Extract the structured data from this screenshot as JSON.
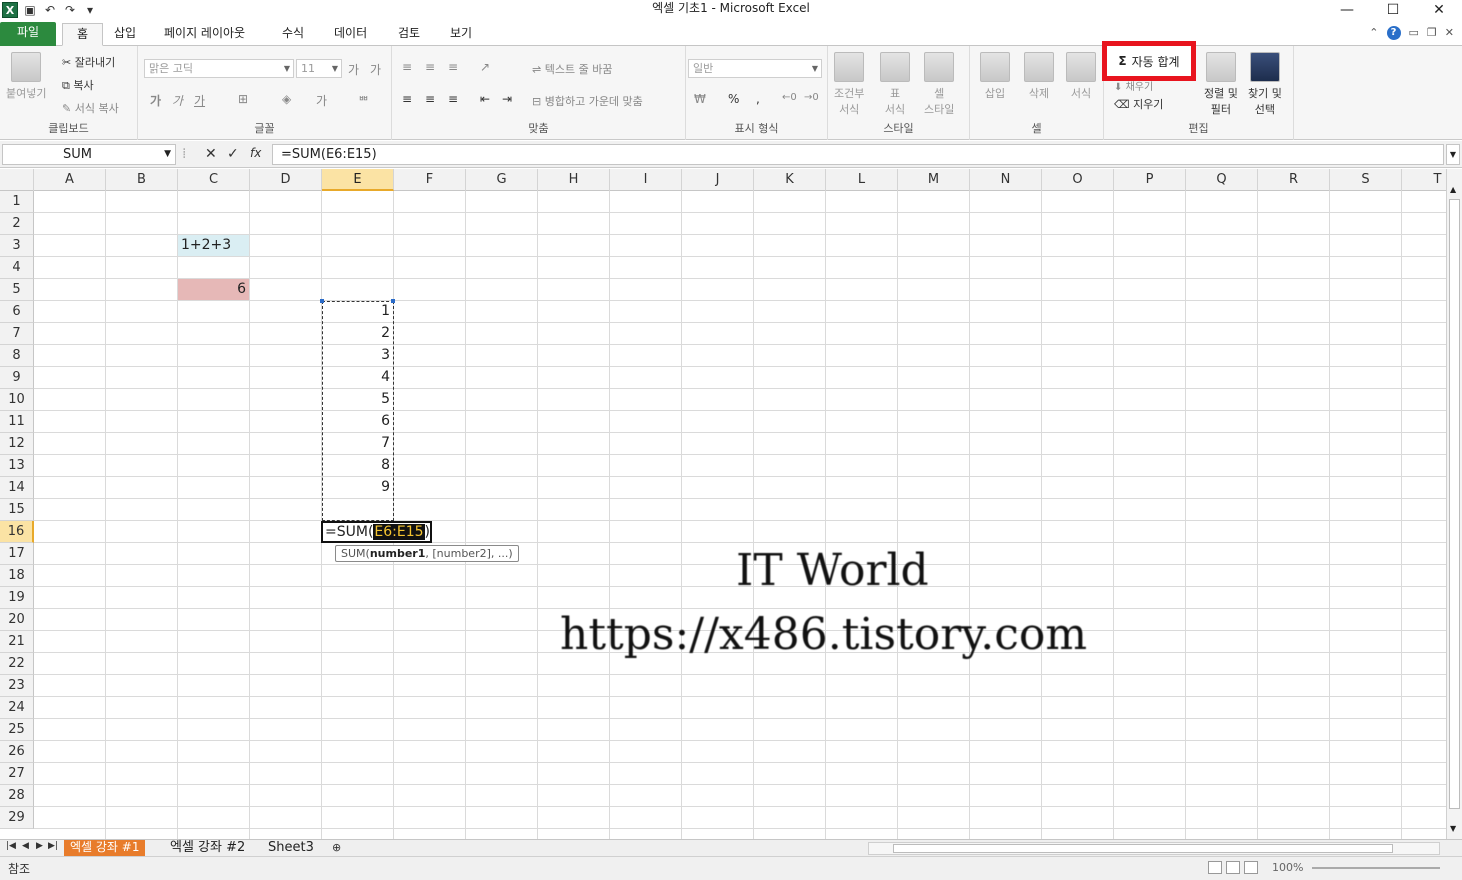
{
  "window": {
    "title": "엑셀 기초1  -  Microsoft Excel",
    "qat": [
      "save-icon",
      "undo-icon",
      "redo-icon",
      "customize-icon"
    ],
    "controls": [
      "—",
      "☐",
      "✕"
    ]
  },
  "tabs": [
    {
      "label": "파일"
    },
    {
      "label": "홈"
    },
    {
      "label": "삽입"
    },
    {
      "label": "페이지 레이아웃"
    },
    {
      "label": "수식"
    },
    {
      "label": "데이터"
    },
    {
      "label": "검토"
    },
    {
      "label": "보기"
    }
  ],
  "ribbon": {
    "clipboard": {
      "label": "클립보드",
      "paste": "붙여넣기",
      "cut": "잘라내기",
      "copy": "복사",
      "format_painter": "서식 복사"
    },
    "font": {
      "label": "글꼴",
      "font_name": "맑은 고딕",
      "font_size": "11",
      "bold": "가",
      "italic": "가",
      "underline": "가"
    },
    "alignment": {
      "label": "맞춤",
      "wrap_text": "텍스트 줄 바꿈",
      "merge_center": "병합하고 가운데 맞춤"
    },
    "number": {
      "label": "표시 형식",
      "format": "일반",
      "percent": "%",
      "comma": ","
    },
    "styles": {
      "label": "스타일",
      "conditional": "조건부\n서식",
      "table": "표\n서식",
      "cell_style": "셀\n스타일"
    },
    "cells": {
      "label": "셀",
      "insert": "삽입",
      "delete": "삭제",
      "format": "서식"
    },
    "editing": {
      "label": "편집",
      "autosum": "자동 합계",
      "fill": "채우기",
      "clear": "지우기",
      "sort_filter": "정렬 및\n필터",
      "find_select": "찾기 및\n선택"
    }
  },
  "formula_bar": {
    "name_box": "SUM",
    "cancel": "✕",
    "enter": "✓",
    "fx": "fx",
    "formula": "=SUM(E6:E15)"
  },
  "grid": {
    "columns": [
      "A",
      "B",
      "C",
      "D",
      "E",
      "F",
      "G",
      "H",
      "I",
      "J",
      "K",
      "L",
      "M",
      "N",
      "O",
      "P",
      "Q",
      "R",
      "S",
      "T"
    ],
    "rows": [
      "1",
      "2",
      "3",
      "4",
      "5",
      "6",
      "7",
      "8",
      "9",
      "10",
      "11",
      "12",
      "13",
      "14",
      "15",
      "16",
      "17",
      "18",
      "19",
      "20",
      "21",
      "22",
      "23",
      "24",
      "25",
      "26",
      "27",
      "28",
      "29"
    ],
    "selected_column": "E",
    "selected_row": "16",
    "c3": "1+2+3",
    "c5": "6",
    "e_values": [
      "1",
      "2",
      "3",
      "4",
      "5",
      "6",
      "7",
      "8",
      "9"
    ],
    "edit_prefix": "=SUM(",
    "edit_ref": "E6:E15",
    "edit_suffix": ")",
    "tooltip_fn": "SUM(",
    "tooltip_arg1": "number1",
    "tooltip_rest": ", [number2], ...)",
    "colors": {
      "c3_fill": "#daeef3",
      "c5_fill": "#e6b8b7",
      "selection": "#fbe3a4",
      "autosum_highlight": "#e8141e"
    }
  },
  "watermark": {
    "line1": "IT World",
    "line2": "https://x486.tistory.com"
  },
  "sheets": [
    {
      "label": "엑셀 강좌 #1"
    },
    {
      "label": "엑셀 강좌 #2"
    },
    {
      "label": "Sheet3"
    }
  ],
  "status": {
    "mode": "참조",
    "zoom": "100%"
  }
}
